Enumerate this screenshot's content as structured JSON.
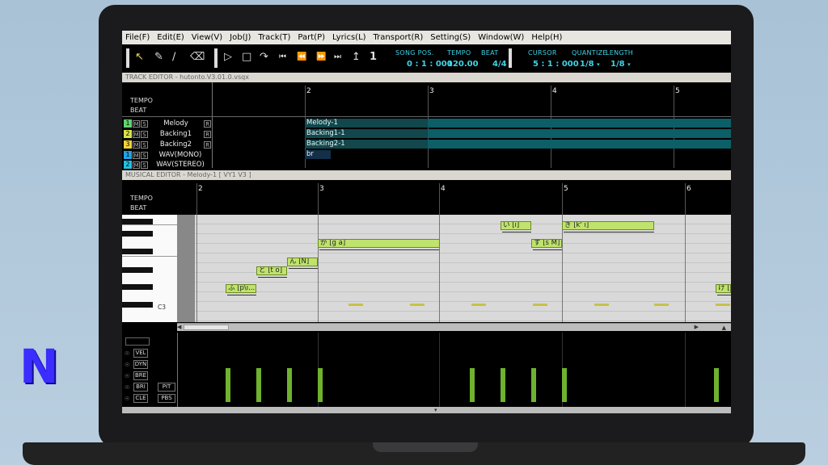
{
  "menu": [
    "File(F)",
    "Edit(E)",
    "View(V)",
    "Job(J)",
    "Track(T)",
    "Part(P)",
    "Lyrics(L)",
    "Transport(R)",
    "Setting(S)",
    "Window(W)",
    "Help(H)"
  ],
  "toolbar": {
    "song_pos_label": "SONG POS.",
    "song_pos_value": "0 : 1 : 000",
    "tempo_label": "TEMPO",
    "tempo_value": "120.00",
    "beat_label": "BEAT",
    "beat_value": "4/4",
    "cursor_label": "CURSOR",
    "cursor_value": "5 : 1 : 000",
    "quantize_label": "QUANTIZE",
    "quantize_value": "1/8",
    "length_label": "LENGTH",
    "length_value": "1/8",
    "num1_label": "1",
    "num2_label": "1"
  },
  "track_editor": {
    "title": "TRACK EDITOR - hutonto.V3.01.0.vsqx",
    "tempo_label": "TEMPO",
    "beat_label": "BEAT",
    "measures": [
      "2",
      "3",
      "4",
      "5"
    ],
    "tracks": [
      {
        "num": "1",
        "name": "Melody",
        "color": "#61d36d",
        "part": "Melody-1"
      },
      {
        "num": "2",
        "name": "Backing1",
        "color": "#d6e24a",
        "part": "Backing1-1"
      },
      {
        "num": "3",
        "name": "Backing2",
        "color": "#f3d23a",
        "part": "Backing2-1"
      },
      {
        "num": "1",
        "name": "WAV(MONO)",
        "color": "#1ea5e6",
        "part": "br"
      },
      {
        "num": "2",
        "name": "WAV(STEREO)",
        "color": "#21c0e6",
        "part": ""
      }
    ],
    "ms_m": "M",
    "ms_s": "S",
    "r_label": "R"
  },
  "musical_editor": {
    "title": "MUSICAL EDITOR - Melody-1 [ VY1 V3 ]",
    "tempo_label": "TEMPO",
    "beat_label": "BEAT",
    "measures": [
      "2",
      "3",
      "4",
      "5",
      "6"
    ],
    "c3_label": "C3",
    "notes": [
      {
        "lyric": "ふ [p\\i...",
        "key": "fu"
      },
      {
        "lyric": "と [t o]",
        "key": "to"
      },
      {
        "lyric": "ん [N]",
        "key": "n"
      },
      {
        "lyric": "が [g a]",
        "key": "ga"
      },
      {
        "lyric": "い [i]",
        "key": "i"
      },
      {
        "lyric": "す [s M]",
        "key": "su"
      },
      {
        "lyric": "き [k' i]",
        "key": "ki"
      },
      {
        "lyric": "け [k...",
        "key": "ke"
      }
    ]
  },
  "control_area": {
    "buttons_left": [
      "VEL",
      "DYN",
      "BRE",
      "BRI",
      "CLE"
    ],
    "buttons_right": [
      "",
      "",
      "",
      "PIT",
      "PBS"
    ]
  },
  "logo": "N"
}
